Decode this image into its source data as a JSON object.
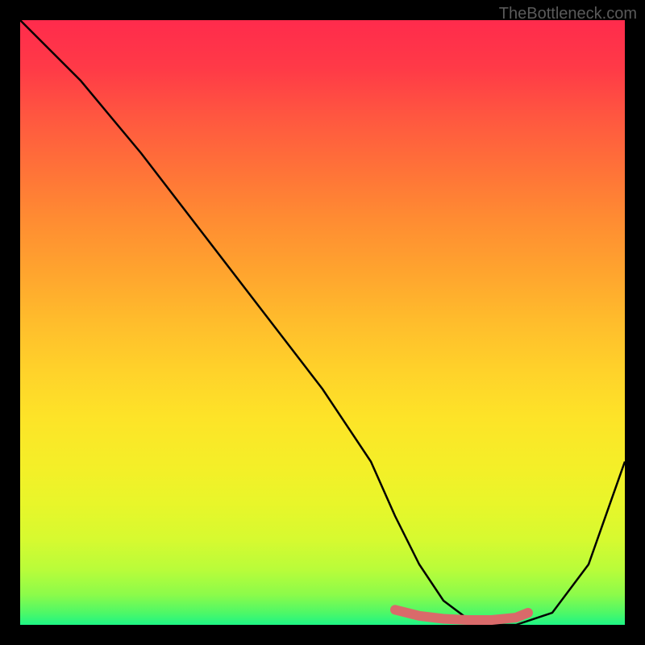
{
  "watermark": "TheBottleneck.com",
  "chart_data": {
    "type": "line",
    "title": "",
    "xlabel": "",
    "ylabel": "",
    "xlim": [
      0,
      100
    ],
    "ylim": [
      0,
      100
    ],
    "series": [
      {
        "name": "bottleneck-curve",
        "x": [
          0,
          4,
          10,
          20,
          30,
          40,
          50,
          58,
          62,
          66,
          70,
          74,
          78,
          82,
          88,
          94,
          100
        ],
        "values": [
          100,
          96,
          90,
          78,
          65,
          52,
          39,
          27,
          18,
          10,
          4,
          1,
          0,
          0,
          2,
          10,
          27
        ]
      }
    ],
    "highlight": {
      "name": "optimal-range",
      "x": [
        62,
        66,
        70,
        74,
        78,
        82,
        84
      ],
      "values": [
        2.5,
        1.5,
        1.0,
        0.8,
        0.8,
        1.2,
        2.0
      ]
    }
  }
}
